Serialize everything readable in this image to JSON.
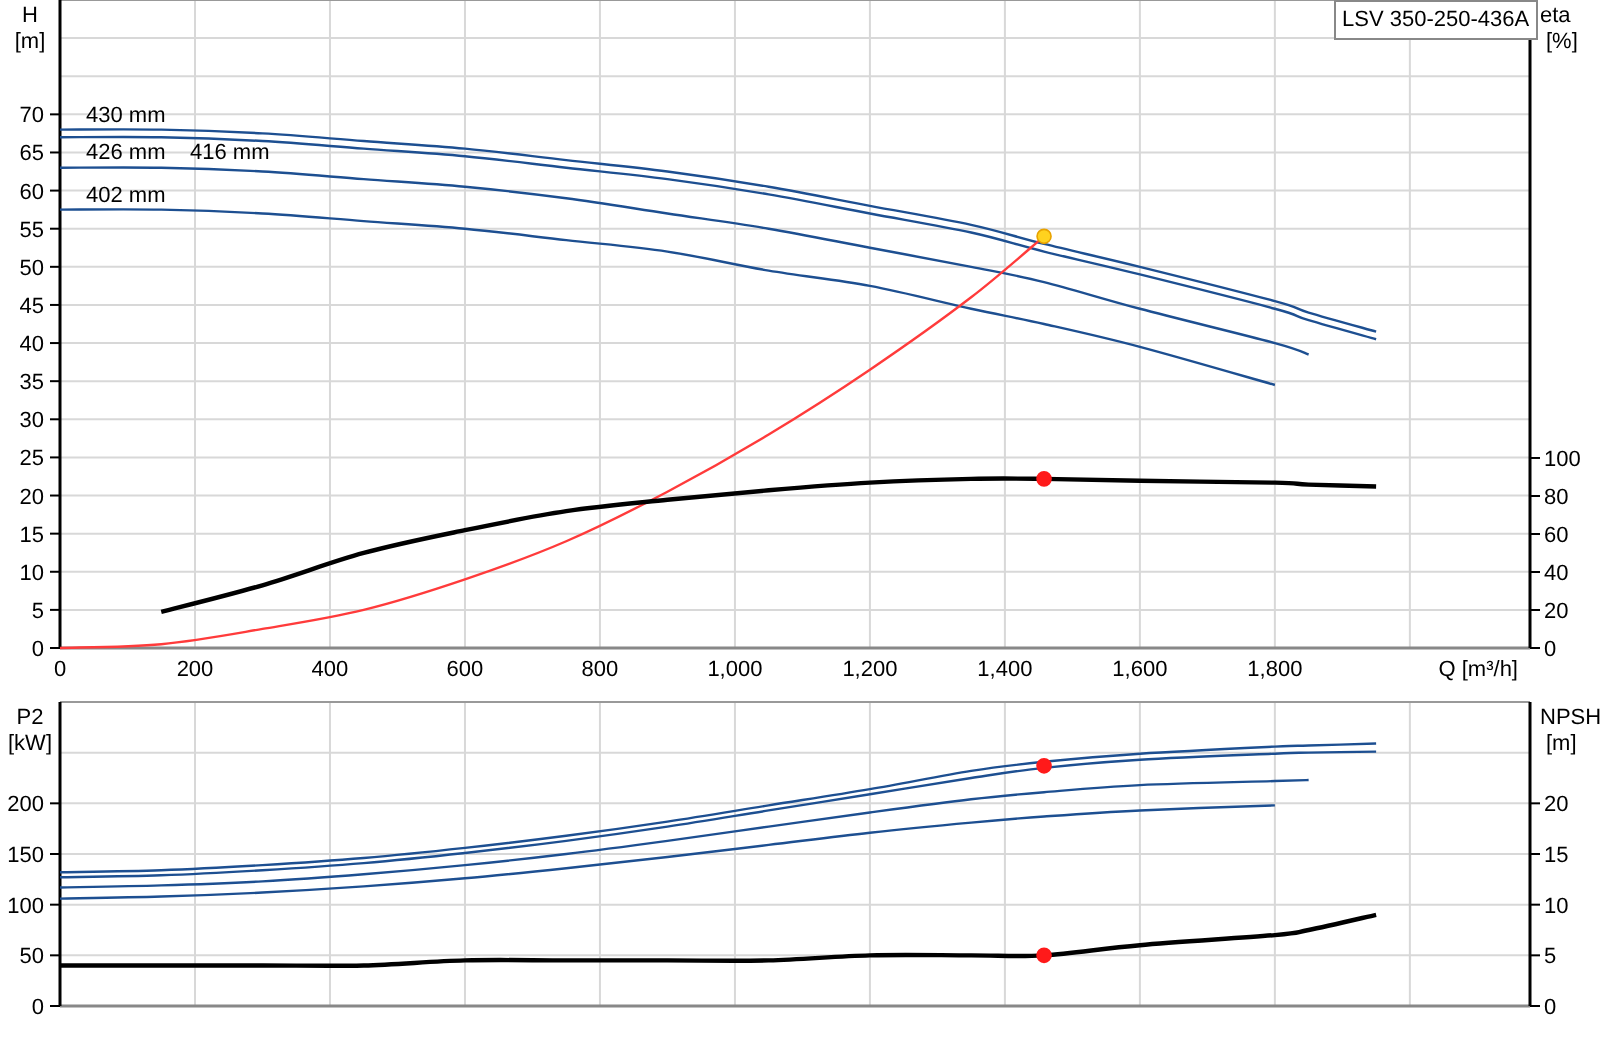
{
  "charts": [
    {
      "chart_data": {
        "type": "line",
        "grid": true,
        "title": "LSV 350-250-436A",
        "xlabel": "Q [m³/h]",
        "ylabel": [
          "H",
          "[m]"
        ],
        "y2label": [
          "eta",
          "[%]"
        ],
        "x": [
          0,
          150,
          300,
          450,
          600,
          750,
          900,
          1050,
          1200,
          1350,
          1458,
          1600,
          1800,
          1850,
          1950
        ],
        "xlim": [
          0,
          2178
        ],
        "ylim": [
          0,
          85
        ],
        "y2lim": [
          0,
          341
        ],
        "xticks": [
          {
            "value": 0,
            "label": "0"
          },
          {
            "value": 200,
            "label": "200"
          },
          {
            "value": 400,
            "label": "400"
          },
          {
            "value": 600,
            "label": "600"
          },
          {
            "value": 800,
            "label": "800"
          },
          {
            "value": 1000,
            "label": "1,000"
          },
          {
            "value": 1200,
            "label": "1,200"
          },
          {
            "value": 1400,
            "label": "1,400"
          },
          {
            "value": 1600,
            "label": "1,600"
          },
          {
            "value": 1800,
            "label": "1,800"
          }
        ],
        "yticks": [
          0,
          5,
          10,
          15,
          20,
          25,
          30,
          35,
          40,
          45,
          50,
          55,
          60,
          65,
          70
        ],
        "y2ticks": [
          0,
          20,
          40,
          60,
          80,
          100
        ],
        "series": [
          {
            "name": "430 mm",
            "color": "#1d4f91",
            "values": [
              68,
              68,
              67.5,
              66.5,
              65.5,
              64,
              62.5,
              60.5,
              58,
              55.5,
              53,
              50,
              45.5,
              44,
              41.5
            ]
          },
          {
            "name": "426 mm",
            "color": "#1d4f91",
            "values": [
              67,
              67,
              66.5,
              65.5,
              64.5,
              63,
              61.5,
              59.5,
              57,
              54.5,
              52,
              49,
              44.5,
              43,
              40.5
            ]
          },
          {
            "name": "416 mm",
            "color": "#1d4f91",
            "values": [
              63,
              63,
              62.5,
              61.5,
              60.5,
              59,
              57,
              55,
              52.5,
              50,
              48,
              44.5,
              40,
              38.5,
              null
            ]
          },
          {
            "name": "402 mm",
            "color": "#1d4f91",
            "values": [
              57.5,
              57.5,
              57,
              56,
              55,
              53.5,
              52,
              49.5,
              47.5,
              44.5,
              42.5,
              39.5,
              34.5,
              null,
              null
            ]
          },
          {
            "color": "#ff3b3b",
            "values": [
              0,
              0.5,
              2.5,
              5,
              9,
              14,
              20.5,
              28,
              36.5,
              46,
              54,
              null,
              null,
              null,
              null
            ]
          },
          {
            "axis": "y2",
            "color": "#000000",
            "values": [
              null,
              19,
              33,
              50,
              62,
              72,
              78,
              83,
              87,
              89,
              89,
              88,
              87,
              86,
              85
            ]
          },
          {
            "color": "#ffd21f",
            "marker": "circle",
            "values": [
              null,
              null,
              null,
              null,
              null,
              null,
              null,
              null,
              null,
              null,
              54,
              null,
              null,
              null,
              null
            ]
          },
          {
            "axis": "y2",
            "color": "#ff1a1a",
            "marker": "circle",
            "values": [
              null,
              null,
              null,
              null,
              null,
              null,
              null,
              null,
              null,
              null,
              89,
              null,
              null,
              null,
              null
            ]
          }
        ]
      }
    },
    {
      "chart_data": {
        "type": "line",
        "grid": true,
        "ylabel": [
          "P2",
          "[kW]"
        ],
        "y2label": [
          "NPSH",
          "[m]"
        ],
        "x": [
          0,
          150,
          300,
          450,
          600,
          750,
          900,
          1050,
          1200,
          1350,
          1458,
          1600,
          1800,
          1850,
          1950
        ],
        "xlim": [
          0,
          2178
        ],
        "ylim": [
          0,
          300
        ],
        "y2lim": [
          0,
          30
        ],
        "yticks": [
          0,
          50,
          100,
          150,
          200
        ],
        "y2ticks": [
          0,
          5,
          10,
          15,
          20
        ],
        "series": [
          {
            "color": "#1d4f91",
            "values": [
              132,
              134,
              139,
              146,
              156,
              168,
              182,
              198,
              214,
              232,
              241,
              249,
              256,
              257,
              259
            ]
          },
          {
            "color": "#1d4f91",
            "values": [
              127,
              129,
              134,
              141,
              151,
              163,
              177,
              193,
              209,
              225,
              235,
              243,
              249,
              250,
              251
            ]
          },
          {
            "color": "#1d4f91",
            "values": [
              117,
              119,
              123,
              130,
              139,
              150,
              163,
              177,
              191,
              204,
              211,
              218,
              222,
              223,
              null
            ]
          },
          {
            "color": "#1d4f91",
            "values": [
              106,
              108,
              112,
              118,
              126,
              136,
              147,
              159,
              171,
              181,
              187,
              193,
              198,
              null,
              null
            ]
          },
          {
            "axis": "y2",
            "color": "#000000",
            "values": [
              4,
              4,
              4,
              4,
              4.5,
              4.5,
              4.5,
              4.5,
              5,
              5,
              5,
              6,
              7,
              7.5,
              9
            ]
          },
          {
            "color": "#ff1a1a",
            "marker": "circle",
            "values": [
              null,
              null,
              null,
              null,
              null,
              null,
              null,
              null,
              null,
              null,
              237,
              null,
              null,
              null,
              null
            ]
          },
          {
            "axis": "y2",
            "color": "#ff1a1a",
            "marker": "circle",
            "values": [
              null,
              null,
              null,
              null,
              null,
              null,
              null,
              null,
              null,
              null,
              5,
              null,
              null,
              null,
              null
            ]
          }
        ]
      }
    }
  ]
}
